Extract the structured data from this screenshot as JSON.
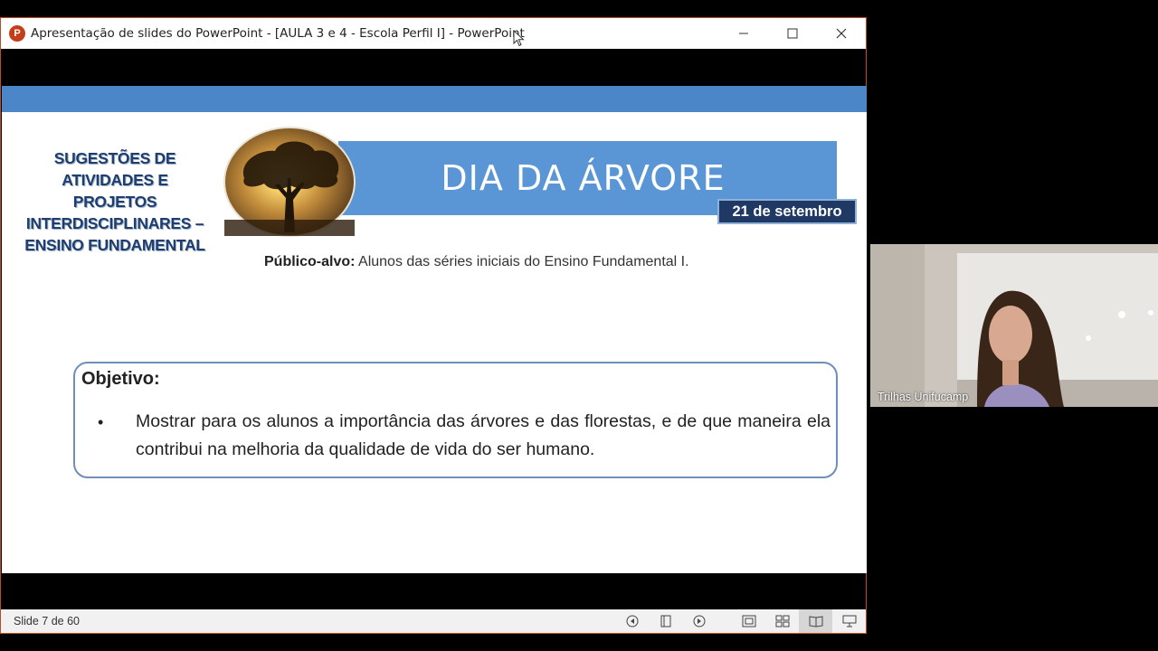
{
  "window": {
    "title": "Apresentação de slides do PowerPoint - [AULA 3 e 4 - Escola Perfil I] - PowerPoint",
    "app_icon": "P"
  },
  "slide": {
    "side_title": "SUGESTÕES DE ATIVIDADES E PROJETOS INTERDISCIPLINARES – ENSINO FUNDAMENTAL",
    "banner": "DIA DA ÁRVORE",
    "date": "21 de setembro",
    "publico_label": "Público-alvo:",
    "publico_text": " Alunos das séries iniciais do Ensino Fundamental I.",
    "objective_title": "Objetivo:",
    "objective_bullet": "•",
    "objective_text": "Mostrar para os alunos a importância das árvores e das florestas, e de que maneira ela contribui na melhoria da qualidade de vida do ser humano."
  },
  "statusbar": {
    "slide_counter": "Slide 7 de 60"
  },
  "video": {
    "participant": "Trilhas Unifucamp"
  },
  "colors": {
    "accent_band": "#4a86c8",
    "banner": "#5a95d5",
    "date_badge": "#1f3864"
  }
}
